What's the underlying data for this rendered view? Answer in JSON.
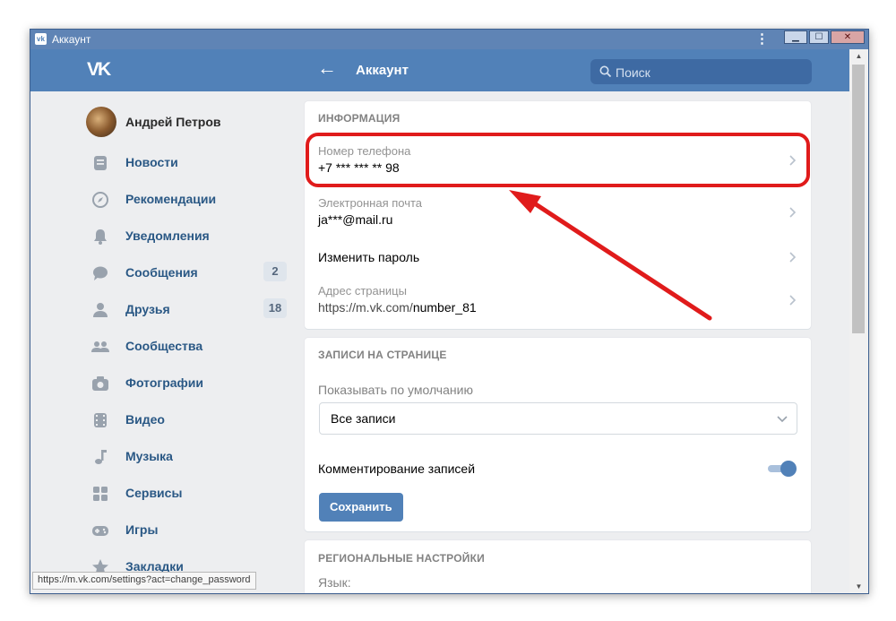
{
  "window": {
    "title": "Аккаунт",
    "app_icon_label": "vk",
    "menu_glyph": "⋮",
    "minimize": "▁",
    "maximize": "☐",
    "close": "✕"
  },
  "header": {
    "logo": "VK",
    "back": "←",
    "title": "Аккаунт",
    "search_placeholder": "Поиск"
  },
  "sidebar": {
    "profile_name": "Андрей Петров",
    "items": [
      {
        "label": "Новости",
        "icon": "news-icon"
      },
      {
        "label": "Рекомендации",
        "icon": "compass-icon"
      },
      {
        "label": "Уведомления",
        "icon": "bell-icon"
      },
      {
        "label": "Сообщения",
        "icon": "chat-icon",
        "count": "2"
      },
      {
        "label": "Друзья",
        "icon": "person-icon",
        "count": "18"
      },
      {
        "label": "Сообщества",
        "icon": "group-icon"
      },
      {
        "label": "Фотографии",
        "icon": "camera-icon"
      },
      {
        "label": "Видео",
        "icon": "film-icon"
      },
      {
        "label": "Музыка",
        "icon": "music-note-icon"
      },
      {
        "label": "Сервисы",
        "icon": "grid-icon"
      },
      {
        "label": "Игры",
        "icon": "gamepad-icon"
      },
      {
        "label": "Закладки",
        "icon": "star-icon"
      }
    ]
  },
  "status_url": "https://m.vk.com/settings?act=change_password",
  "info": {
    "title": "ИНФОРМАЦИЯ",
    "phone_label": "Номер телефона",
    "phone_value": "+7 *** *** ** 98",
    "email_label": "Электронная почта",
    "email_value": "ja***@mail.ru",
    "change_password": "Изменить пароль",
    "address_label": "Адрес страницы",
    "address_prefix": "https://m.vk.com/",
    "address_id": "number_81"
  },
  "posts": {
    "title": "ЗАПИСИ НА СТРАНИЦЕ",
    "default_label": "Показывать по умолчанию",
    "default_value": "Все записи",
    "comments_label": "Комментирование записей",
    "comments_enabled": true,
    "save_label": "Сохранить"
  },
  "regional": {
    "title": "РЕГИОНАЛЬНЫЕ НАСТРОЙКИ",
    "language_label": "Язык:"
  },
  "colors": {
    "header": "#5181b8",
    "accent": "#5181b8",
    "annotation": "#e01b1b",
    "background": "#edeef0"
  }
}
